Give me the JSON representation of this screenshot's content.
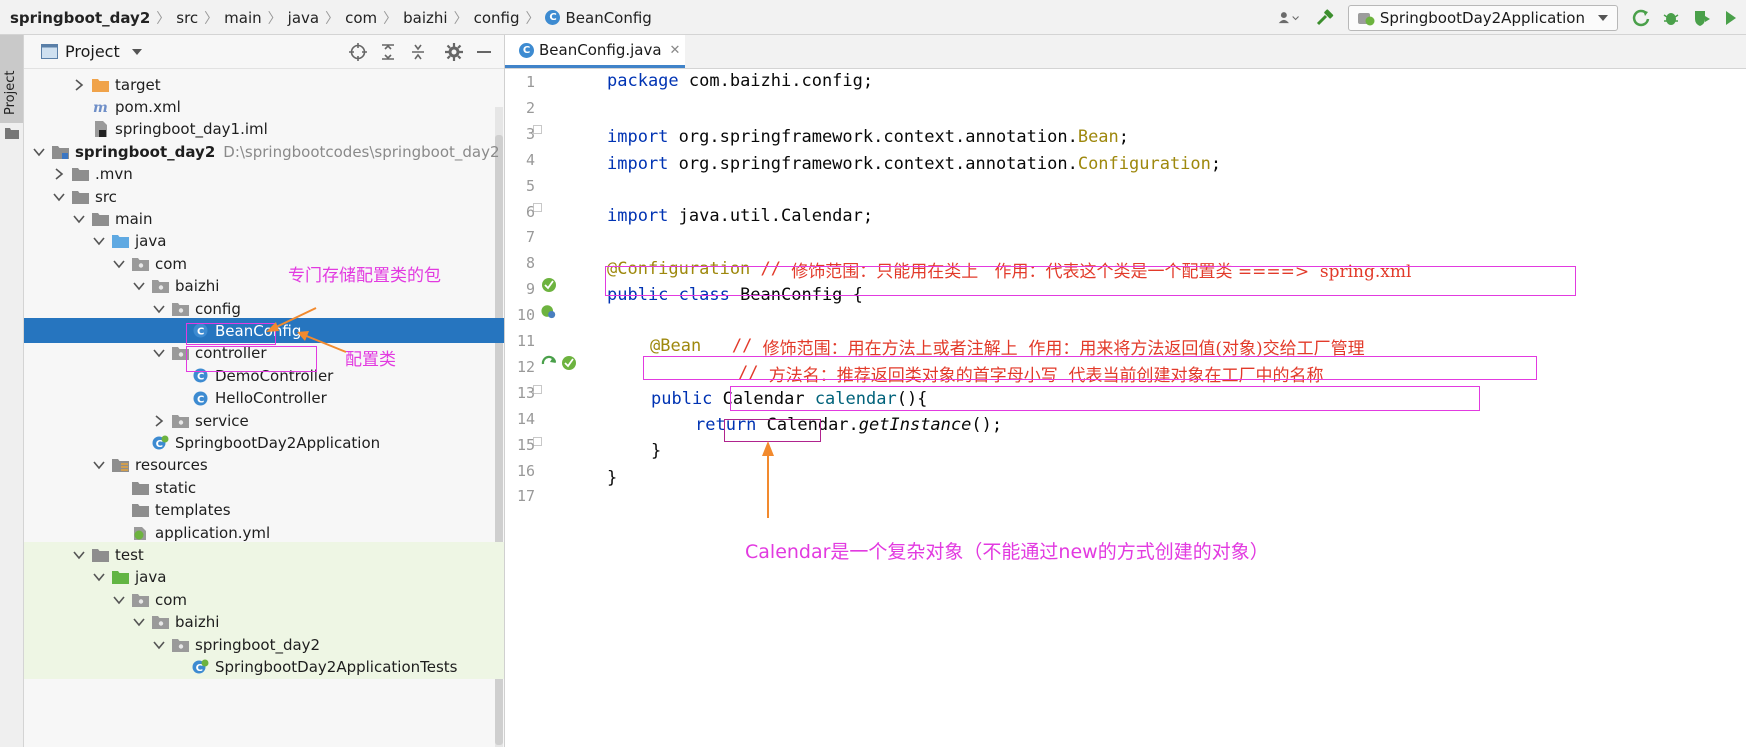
{
  "breadcrumb": [
    "springboot_day2",
    "src",
    "main",
    "java",
    "com",
    "baizhi",
    "config",
    "BeanConfig"
  ],
  "run_config": {
    "label": "SpringbootDay2Application"
  },
  "toolstrip": {
    "project_tab": "Project"
  },
  "project_panel": {
    "title": "Project",
    "tree": [
      {
        "label": "target",
        "icon": "folder-orange-icon",
        "arrow": "right",
        "path": ""
      },
      {
        "label": "pom.xml",
        "icon": "maven-icon",
        "arrow": "",
        "path": ""
      },
      {
        "label": "springboot_day1.iml",
        "icon": "iml-file-icon",
        "arrow": "",
        "path": ""
      },
      {
        "label": "springboot_day2",
        "icon": "module-folder-icon",
        "arrow": "down",
        "path": "D:\\springbootcodes\\springboot_day2"
      },
      {
        "label": ".mvn",
        "icon": "folder-icon",
        "arrow": "right",
        "path": ""
      },
      {
        "label": "src",
        "icon": "folder-icon",
        "arrow": "down",
        "path": ""
      },
      {
        "label": "main",
        "icon": "folder-icon",
        "arrow": "down",
        "path": ""
      },
      {
        "label": "java",
        "icon": "folder-blue-icon",
        "arrow": "down",
        "path": ""
      },
      {
        "label": "com",
        "icon": "package-icon",
        "arrow": "down",
        "path": ""
      },
      {
        "label": "baizhi",
        "icon": "package-icon",
        "arrow": "down",
        "path": ""
      },
      {
        "label": "config",
        "icon": "package-icon",
        "arrow": "down",
        "path": ""
      },
      {
        "label": "BeanConfig",
        "icon": "class-icon",
        "arrow": "",
        "path": ""
      },
      {
        "label": "controller",
        "icon": "package-icon",
        "arrow": "down",
        "path": ""
      },
      {
        "label": "DemoController",
        "icon": "class-icon",
        "arrow": "",
        "path": ""
      },
      {
        "label": "HelloController",
        "icon": "class-icon",
        "arrow": "",
        "path": ""
      },
      {
        "label": "service",
        "icon": "package-icon",
        "arrow": "right",
        "path": ""
      },
      {
        "label": "SpringbootDay2Application",
        "icon": "spring-class-icon",
        "arrow": "",
        "path": ""
      },
      {
        "label": "resources",
        "icon": "resources-folder-icon",
        "arrow": "down",
        "path": ""
      },
      {
        "label": "static",
        "icon": "folder-icon",
        "arrow": "",
        "path": ""
      },
      {
        "label": "templates",
        "icon": "folder-icon",
        "arrow": "",
        "path": ""
      },
      {
        "label": "application.yml",
        "icon": "spring-yml-icon",
        "arrow": "",
        "path": ""
      },
      {
        "label": "test",
        "icon": "folder-icon",
        "arrow": "down",
        "path": ""
      },
      {
        "label": "java",
        "icon": "folder-green-icon",
        "arrow": "down",
        "path": ""
      },
      {
        "label": "com",
        "icon": "package-icon",
        "arrow": "down",
        "path": ""
      },
      {
        "label": "baizhi",
        "icon": "package-icon",
        "arrow": "down",
        "path": ""
      },
      {
        "label": "springboot_day2",
        "icon": "package-icon",
        "arrow": "down",
        "path": ""
      },
      {
        "label": "SpringbootDay2ApplicationTests",
        "icon": "spring-class-icon",
        "arrow": "",
        "path": ""
      }
    ],
    "annotations": {
      "config_note": "专门存储配置类的包",
      "class_note": "配置类"
    }
  },
  "editor": {
    "tab": {
      "label": "BeanConfig.java"
    },
    "line_numbers": [
      "1",
      "2",
      "3",
      "4",
      "5",
      "6",
      "7",
      "8",
      "9",
      "10",
      "11",
      "12",
      "13",
      "14",
      "15",
      "16",
      "17"
    ],
    "code": {
      "l1_kw": "package",
      "l1_rest": " com.baizhi.config;",
      "l3_kw": "import",
      "l3_rest": " org.springframework.context.annotation.",
      "l3_cls": "Bean",
      "l3_end": ";",
      "l4_kw": "import",
      "l4_rest": " org.springframework.context.annotation.",
      "l4_cls": "Configuration",
      "l4_end": ";",
      "l6_kw": "import",
      "l6_rest": " java.util.Calendar;",
      "l8_ann": "@Configuration",
      "l8_cmt_mono": " // ",
      "l8_cmt": "修饰范围：只能用在类上   作用：代表这个类是一个配置类 ====>  spring.xml",
      "l9_kw": "public class",
      "l9_rest": " BeanConfig {",
      "l11_ann": "@Bean",
      "l11_cmt_mono": "   // ",
      "l11_cmt": "修饰范围：用在方法上或者注解上  作用：用来将方法返回值(对象)交给工厂管理",
      "l12_cmt_mono": "// ",
      "l12_cmt": "方法名：推荐返回类对象的首字母小写  代表当前创建对象在工厂中的名称",
      "l13_kw": "public",
      "l13_type": "Calendar",
      "l13_meth": "calendar",
      "l13_end": "(){",
      "l14_kw": "return",
      "l14_rest": " Calendar.",
      "l14_meth": "getInstance",
      "l14_end": "();",
      "l15": "}",
      "l16": "}"
    },
    "note": "Calendar是一个复杂对象（不能通过new的方式创建的对象）"
  },
  "colors": {
    "annotation_magenta": "#e23ae0",
    "selection_blue": "#2675bf",
    "keyword_blue": "#0033b3",
    "annotation_olive": "#9e880d",
    "comment_red": "#e23a2a"
  }
}
